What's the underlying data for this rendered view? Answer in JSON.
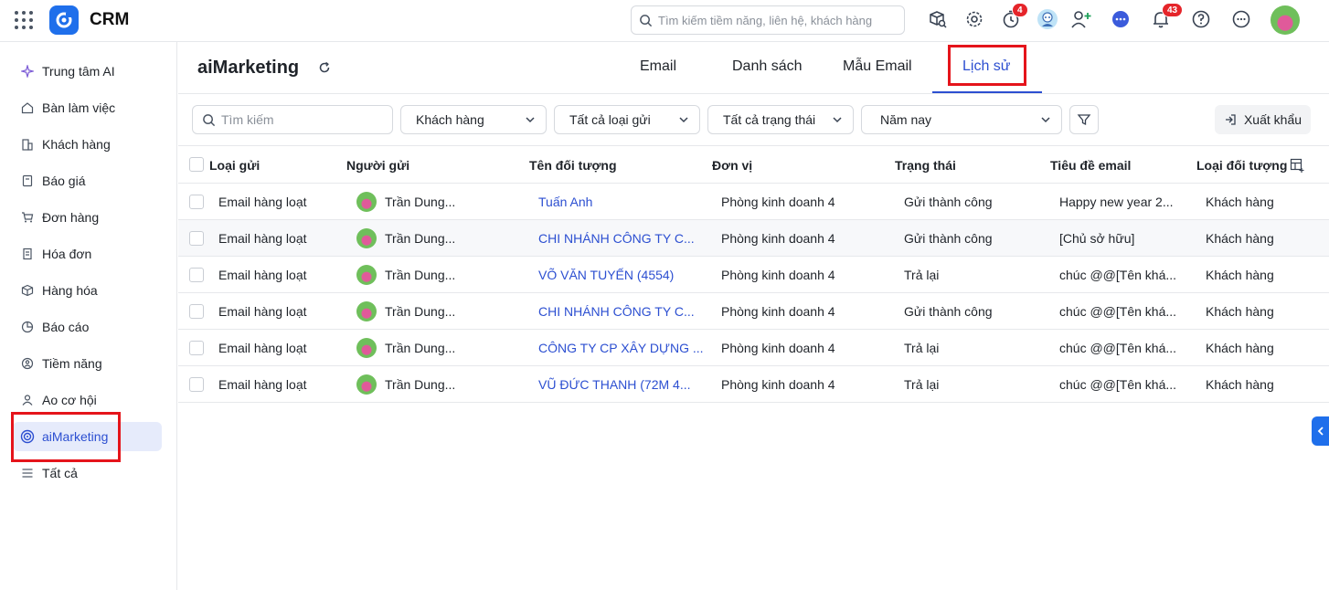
{
  "app": {
    "title": "CRM"
  },
  "topbar": {
    "search_placeholder": "Tìm kiếm tiềm năng, liên hệ, khách hàng",
    "reminder_badge": "4",
    "notification_badge": "43"
  },
  "sidebar": {
    "items": [
      {
        "label": "Trung tâm AI",
        "icon": "sparkle-icon"
      },
      {
        "label": "Bàn làm việc",
        "icon": "home-icon"
      },
      {
        "label": "Khách hàng",
        "icon": "building-icon"
      },
      {
        "label": "Báo giá",
        "icon": "quote-icon"
      },
      {
        "label": "Đơn hàng",
        "icon": "cart-icon"
      },
      {
        "label": "Hóa đơn",
        "icon": "invoice-icon"
      },
      {
        "label": "Hàng hóa",
        "icon": "box-icon"
      },
      {
        "label": "Báo cáo",
        "icon": "report-icon"
      },
      {
        "label": "Tiềm năng",
        "icon": "potential-icon"
      },
      {
        "label": "Ao cơ hội",
        "icon": "opportunity-icon"
      },
      {
        "label": "aiMarketing",
        "icon": "target-icon",
        "active": true
      },
      {
        "label": "Tất cả",
        "icon": "menu-icon"
      }
    ]
  },
  "main": {
    "title": "aiMarketing",
    "tabs": [
      {
        "label": "Email"
      },
      {
        "label": "Danh sách"
      },
      {
        "label": "Mẫu Email"
      },
      {
        "label": "Lịch sử",
        "active": true
      }
    ],
    "filters": {
      "search_placeholder": "Tìm kiếm",
      "object_type": "Khách hàng",
      "send_type": "Tất cả loại gửi",
      "status": "Tất cả trạng thái",
      "period": "Năm nay"
    },
    "export_label": "Xuất khẩu"
  },
  "table": {
    "columns": [
      "Loại gửi",
      "Người gửi",
      "Tên đối tượng",
      "Đơn vị",
      "Trạng thái",
      "Tiêu đề email",
      "Loại đối tượng"
    ],
    "rows": [
      {
        "type": "Email hàng loạt",
        "sender": "Trần Dung...",
        "target": "Tuấn Anh",
        "unit": "Phòng kinh doanh 4",
        "status": "Gửi thành công",
        "subject": "Happy new year 2...",
        "object_type": "Khách hàng"
      },
      {
        "type": "Email hàng loạt",
        "sender": "Trần Dung...",
        "target": "CHI NHÁNH CÔNG TY C...",
        "unit": "Phòng kinh doanh 4",
        "status": "Gửi thành công",
        "subject": "[Chủ sở hữu]",
        "object_type": "Khách hàng"
      },
      {
        "type": "Email hàng loạt",
        "sender": "Trần Dung...",
        "target": "VÕ VĂN TUYẾN (4554)",
        "unit": "Phòng kinh doanh 4",
        "status": "Trả lại",
        "subject": "chúc @@[Tên khá...",
        "object_type": "Khách hàng"
      },
      {
        "type": "Email hàng loạt",
        "sender": "Trần Dung...",
        "target": "CHI NHÁNH CÔNG TY C...",
        "unit": "Phòng kinh doanh 4",
        "status": "Gửi thành công",
        "subject": "chúc @@[Tên khá...",
        "object_type": "Khách hàng"
      },
      {
        "type": "Email hàng loạt",
        "sender": "Trần Dung...",
        "target": "CÔNG TY CP XÂY DỰNG ...",
        "unit": "Phòng kinh doanh 4",
        "status": "Trả lại",
        "subject": "chúc @@[Tên khá...",
        "object_type": "Khách hàng"
      },
      {
        "type": "Email hàng loạt",
        "sender": "Trần Dung...",
        "target": "VŨ ĐỨC THANH (72M 4...",
        "unit": "Phòng kinh doanh 4",
        "status": "Trả lại",
        "subject": "chúc @@[Tên khá...",
        "object_type": "Khách hàng"
      }
    ]
  },
  "colors": {
    "accent": "#2c4fd1",
    "brand": "#1f6feb",
    "badge": "#e5252a",
    "highlight_box": "#e5141b"
  }
}
